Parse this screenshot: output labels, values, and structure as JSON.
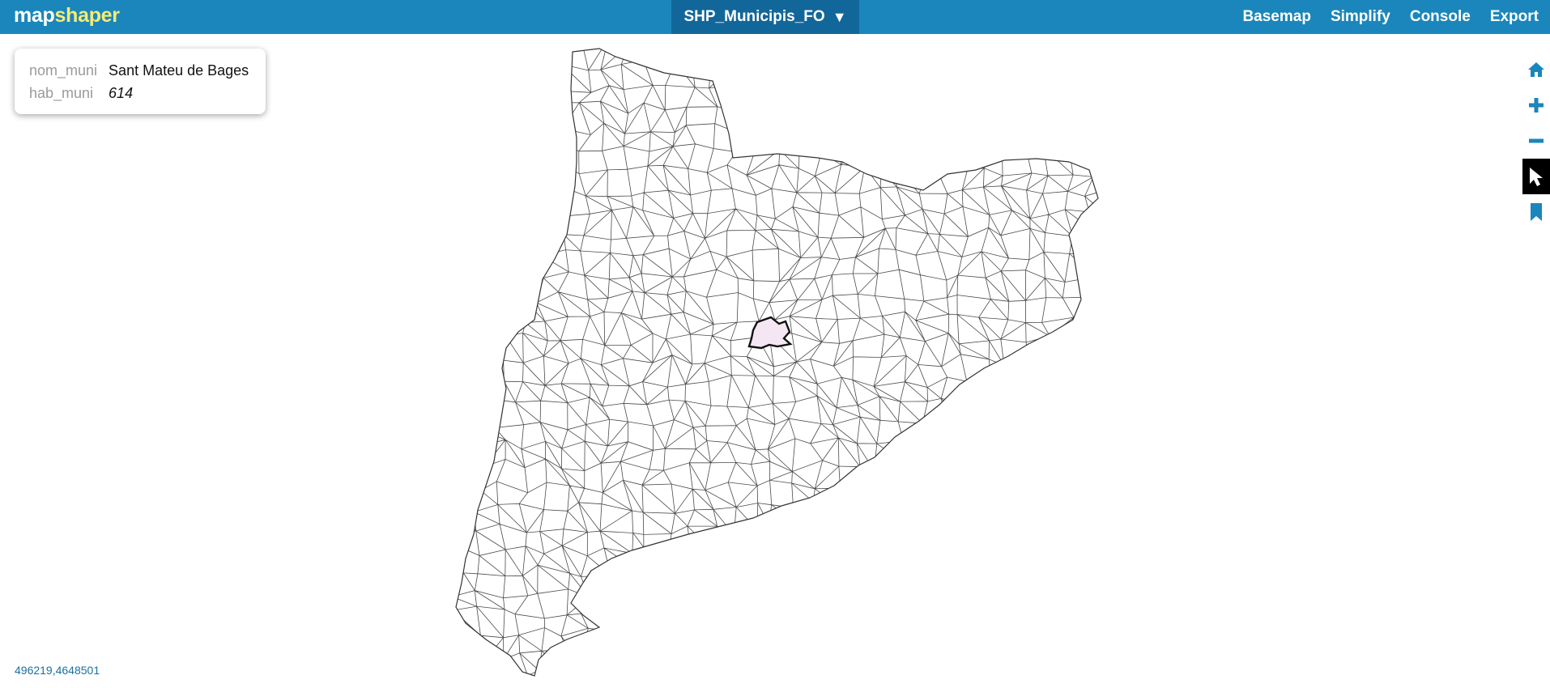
{
  "app": {
    "logo_part1": "map",
    "logo_part2": "shaper"
  },
  "layer_menu": {
    "label": "SHP_Municipis_FO",
    "caret": "▼"
  },
  "nav": {
    "basemap": "Basemap",
    "simplify": "Simplify",
    "console": "Console",
    "export": "Export"
  },
  "popup": {
    "rows": [
      {
        "key": "nom_muni",
        "value": "Sant Mateu de Bages"
      },
      {
        "key": "hab_muni",
        "value": "614"
      }
    ]
  },
  "tools": [
    "home-icon",
    "zoom-in-icon",
    "zoom-out-icon",
    "pointer-select-icon",
    "bookmark-icon"
  ],
  "colors": {
    "topbar": "#1b86bb",
    "layer_menu_bg": "#12679a",
    "logo_accent": "#f4ec76",
    "tool_icon": "#1b86bb",
    "selected_outline": "#111111",
    "selected_fill": "#f4e6f2"
  },
  "status": {
    "coordinates": "496219,4648501"
  }
}
